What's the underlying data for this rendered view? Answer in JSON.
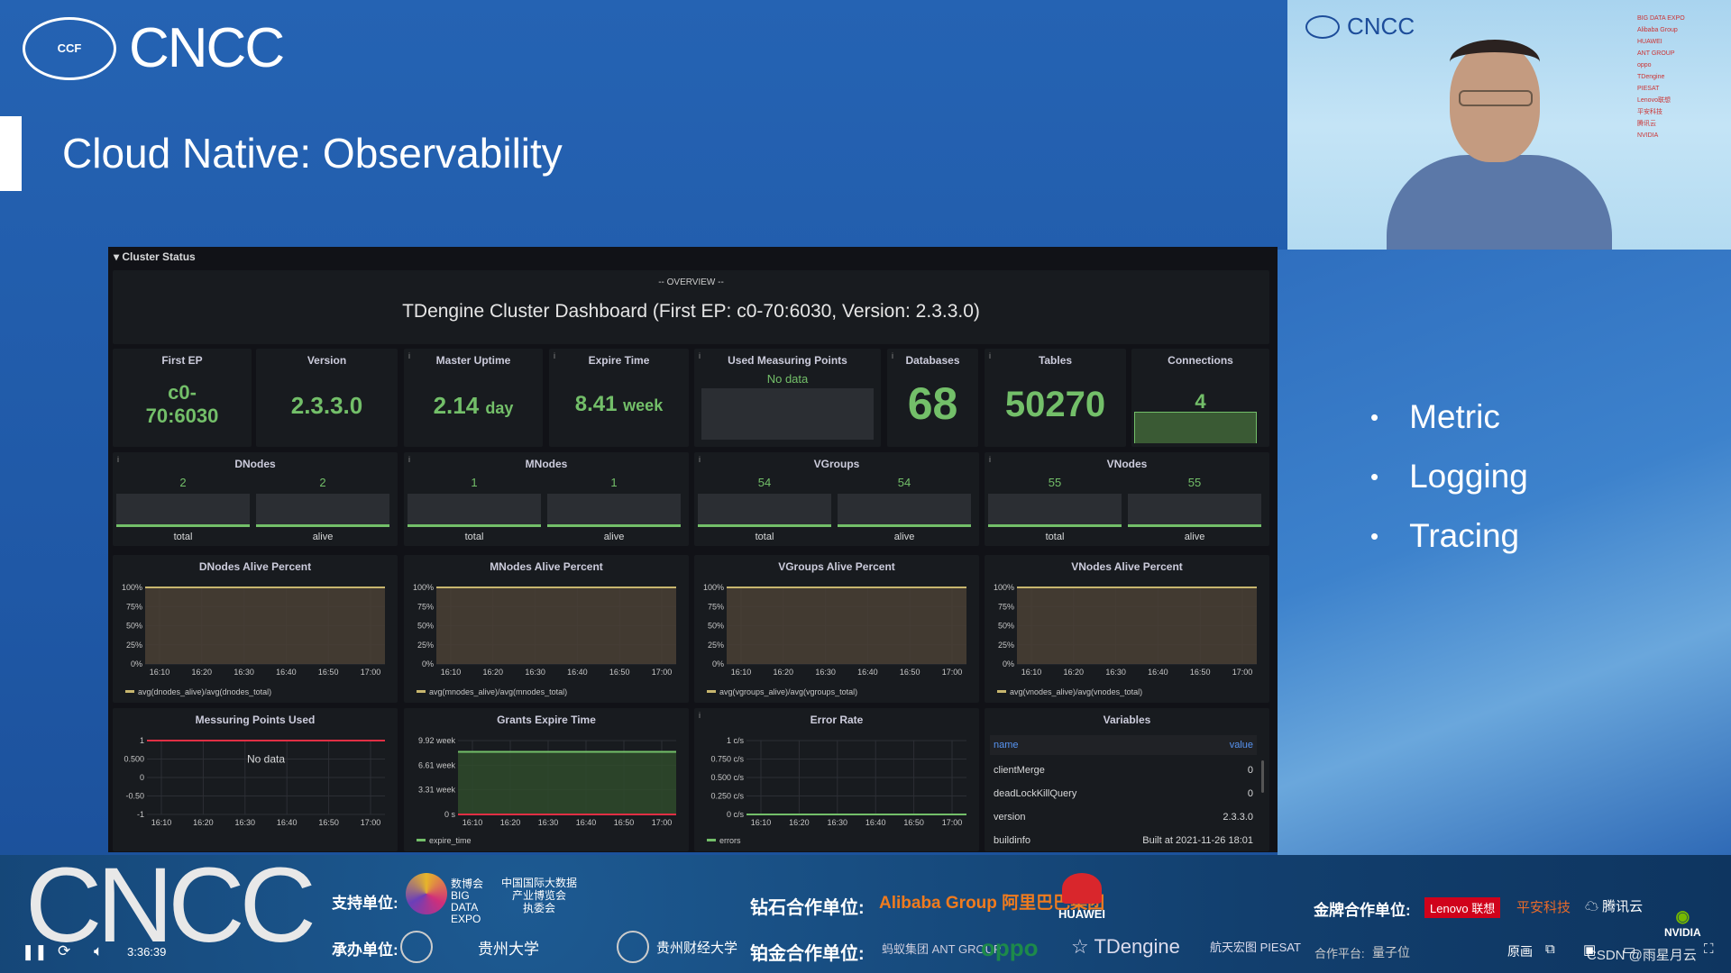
{
  "slide": {
    "logo_text": "CNCC",
    "seal_text": "CCF",
    "title": "Cloud Native: Observability",
    "bullets": [
      "Metric",
      "Logging",
      "Tracing"
    ]
  },
  "webcam": {
    "logo_text": "CNCC",
    "sponsors": [
      "BIG DATA EXPO",
      "Alibaba Group",
      "HUAWEI",
      "ANT GROUP",
      "oppo",
      "TDengine",
      "PIESAT",
      "Lenovo联想",
      "平安科技",
      "腾讯云",
      "NVIDIA"
    ]
  },
  "dashboard": {
    "row_title": "Cluster Status",
    "overview_label": "-- OVERVIEW --",
    "overview_title": "TDengine Cluster Dashboard (First EP: c0-70:6030, Version: 2.3.3.0)",
    "stats": [
      {
        "title": "First EP",
        "value": "c0-\n70:6030",
        "unit": ""
      },
      {
        "title": "Version",
        "value": "2.3.3.0",
        "unit": ""
      },
      {
        "title": "Master Uptime",
        "value": "2.14",
        "unit": "day"
      },
      {
        "title": "Expire Time",
        "value": "8.41",
        "unit": "week"
      },
      {
        "title": "Used Measuring Points",
        "value": "No data",
        "unit": ""
      },
      {
        "title": "Databases",
        "value": "68",
        "unit": ""
      },
      {
        "title": "Tables",
        "value": "50270",
        "unit": ""
      },
      {
        "title": "Connections",
        "value": "4",
        "unit": ""
      }
    ],
    "nodes": [
      {
        "title": "DNodes",
        "total": "2",
        "alive": "2",
        "total_label": "total",
        "alive_label": "alive"
      },
      {
        "title": "MNodes",
        "total": "1",
        "alive": "1",
        "total_label": "total",
        "alive_label": "alive"
      },
      {
        "title": "VGroups",
        "total": "54",
        "alive": "54",
        "total_label": "total",
        "alive_label": "alive"
      },
      {
        "title": "VNodes",
        "total": "55",
        "alive": "55",
        "total_label": "total",
        "alive_label": "alive"
      }
    ],
    "variables": {
      "title": "Variables",
      "headers": [
        "name",
        "value"
      ],
      "rows": [
        [
          "clientMerge",
          "0"
        ],
        [
          "deadLockKillQuery",
          "0"
        ],
        [
          "version",
          "2.3.3.0"
        ],
        [
          "buildinfo",
          "Built at 2021-11-26 18:01"
        ]
      ]
    },
    "colors": {
      "green": "#73bf69",
      "red": "#e02f44",
      "yellow": "#c8b66e",
      "link": "#5794f2"
    }
  },
  "chart_data": [
    {
      "type": "area",
      "title": "DNodes Alive Percent",
      "x": [
        "16:10",
        "16:20",
        "16:30",
        "16:40",
        "16:50",
        "17:00"
      ],
      "ylim": [
        0,
        100
      ],
      "yticks": [
        0,
        25,
        50,
        75,
        100
      ],
      "ytick_labels": [
        "0%",
        "25%",
        "50%",
        "75%",
        "100%"
      ],
      "series": [
        {
          "name": "avg(dnodes_alive)/avg(dnodes_total)",
          "values": [
            100,
            100,
            100,
            100,
            100,
            100
          ],
          "color": "#c8b66e"
        }
      ],
      "grid": true
    },
    {
      "type": "area",
      "title": "MNodes Alive Percent",
      "x": [
        "16:10",
        "16:20",
        "16:30",
        "16:40",
        "16:50",
        "17:00"
      ],
      "ylim": [
        0,
        100
      ],
      "yticks": [
        0,
        25,
        50,
        75,
        100
      ],
      "ytick_labels": [
        "0%",
        "25%",
        "50%",
        "75%",
        "100%"
      ],
      "series": [
        {
          "name": "avg(mnodes_alive)/avg(mnodes_total)",
          "values": [
            100,
            100,
            100,
            100,
            100,
            100
          ],
          "color": "#c8b66e"
        }
      ],
      "grid": true
    },
    {
      "type": "area",
      "title": "VGroups Alive Percent",
      "x": [
        "16:10",
        "16:20",
        "16:30",
        "16:40",
        "16:50",
        "17:00"
      ],
      "ylim": [
        0,
        100
      ],
      "yticks": [
        0,
        25,
        50,
        75,
        100
      ],
      "ytick_labels": [
        "0%",
        "25%",
        "50%",
        "75%",
        "100%"
      ],
      "series": [
        {
          "name": "avg(vgroups_alive)/avg(vgroups_total)",
          "values": [
            100,
            100,
            100,
            100,
            100,
            100
          ],
          "color": "#c8b66e"
        }
      ],
      "grid": true
    },
    {
      "type": "area",
      "title": "VNodes Alive Percent",
      "x": [
        "16:10",
        "16:20",
        "16:30",
        "16:40",
        "16:50",
        "17:00"
      ],
      "ylim": [
        0,
        100
      ],
      "yticks": [
        0,
        25,
        50,
        75,
        100
      ],
      "ytick_labels": [
        "0%",
        "25%",
        "50%",
        "75%",
        "100%"
      ],
      "series": [
        {
          "name": "avg(vnodes_alive)/avg(vnodes_total)",
          "values": [
            100,
            100,
            100,
            100,
            100,
            100
          ],
          "color": "#c8b66e"
        }
      ],
      "grid": true
    },
    {
      "type": "line",
      "title": "Messuring Points Used",
      "x": [
        "16:10",
        "16:20",
        "16:30",
        "16:40",
        "16:50",
        "17:00"
      ],
      "ylim": [
        -1,
        1
      ],
      "yticks": [
        -1,
        -0.5,
        0,
        0.5,
        1
      ],
      "ytick_labels": [
        "-1",
        "-0.50",
        "0",
        "0.500",
        "1"
      ],
      "series": [],
      "threshold": 1,
      "annotation": "No data",
      "grid": true
    },
    {
      "type": "area",
      "title": "Grants Expire Time",
      "x": [
        "16:10",
        "16:20",
        "16:30",
        "16:40",
        "16:50",
        "17:00"
      ],
      "ylim": [
        0,
        9.92
      ],
      "yticks": [
        0,
        3.31,
        6.61,
        9.92
      ],
      "ytick_labels": [
        "0 s",
        "3.31 week",
        "6.61 week",
        "9.92 week"
      ],
      "series": [
        {
          "name": "expire_time",
          "values": [
            8.41,
            8.41,
            8.41,
            8.41,
            8.41,
            8.41
          ],
          "color": "#73bf69"
        }
      ],
      "threshold": 0,
      "grid": true
    },
    {
      "type": "line",
      "title": "Error Rate",
      "x": [
        "16:10",
        "16:20",
        "16:30",
        "16:40",
        "16:50",
        "17:00"
      ],
      "ylim": [
        0,
        1
      ],
      "yticks": [
        0,
        0.25,
        0.5,
        0.75,
        1
      ],
      "ytick_labels": [
        "0 c/s",
        "0.250 c/s",
        "0.500 c/s",
        "0.750 c/s",
        "1 c/s"
      ],
      "series": [
        {
          "name": "errors",
          "values": [
            0,
            0,
            0,
            0,
            0,
            0
          ],
          "color": "#73bf69"
        }
      ],
      "grid": true
    }
  ],
  "banner": {
    "logo_text": "CNCC",
    "support_label": "支持单位:",
    "bigdata_logo": "数博会 BIG DATA EXPO",
    "bigdata_org": "中国国际大数据\n产业博览会\n执委会",
    "host_label": "承办单位:",
    "host1": "贵州大学",
    "host2": "贵州财经大学",
    "diamond_label": "钻石合作单位:",
    "alibaba": "Alibaba Group 阿里巴巴集团",
    "huawei": "HUAWEI",
    "platinum_label": "铂金合作单位:",
    "ant": "蚂蚁集团 ANT GROUP",
    "oppo": "oppo",
    "tdengine": "TDengine",
    "piesat": "航天宏图 PIESAT",
    "gold_label": "金牌合作单位:",
    "lenovo": "Lenovo 联想",
    "pingan": "平安科技",
    "tencent": "腾讯云",
    "nvidia": "NVIDIA",
    "partner_label": "合作平台:",
    "qbit": "量子位",
    "quality": "原画",
    "watermark": "CSDN @雨星月云",
    "time": "3:36:39"
  }
}
